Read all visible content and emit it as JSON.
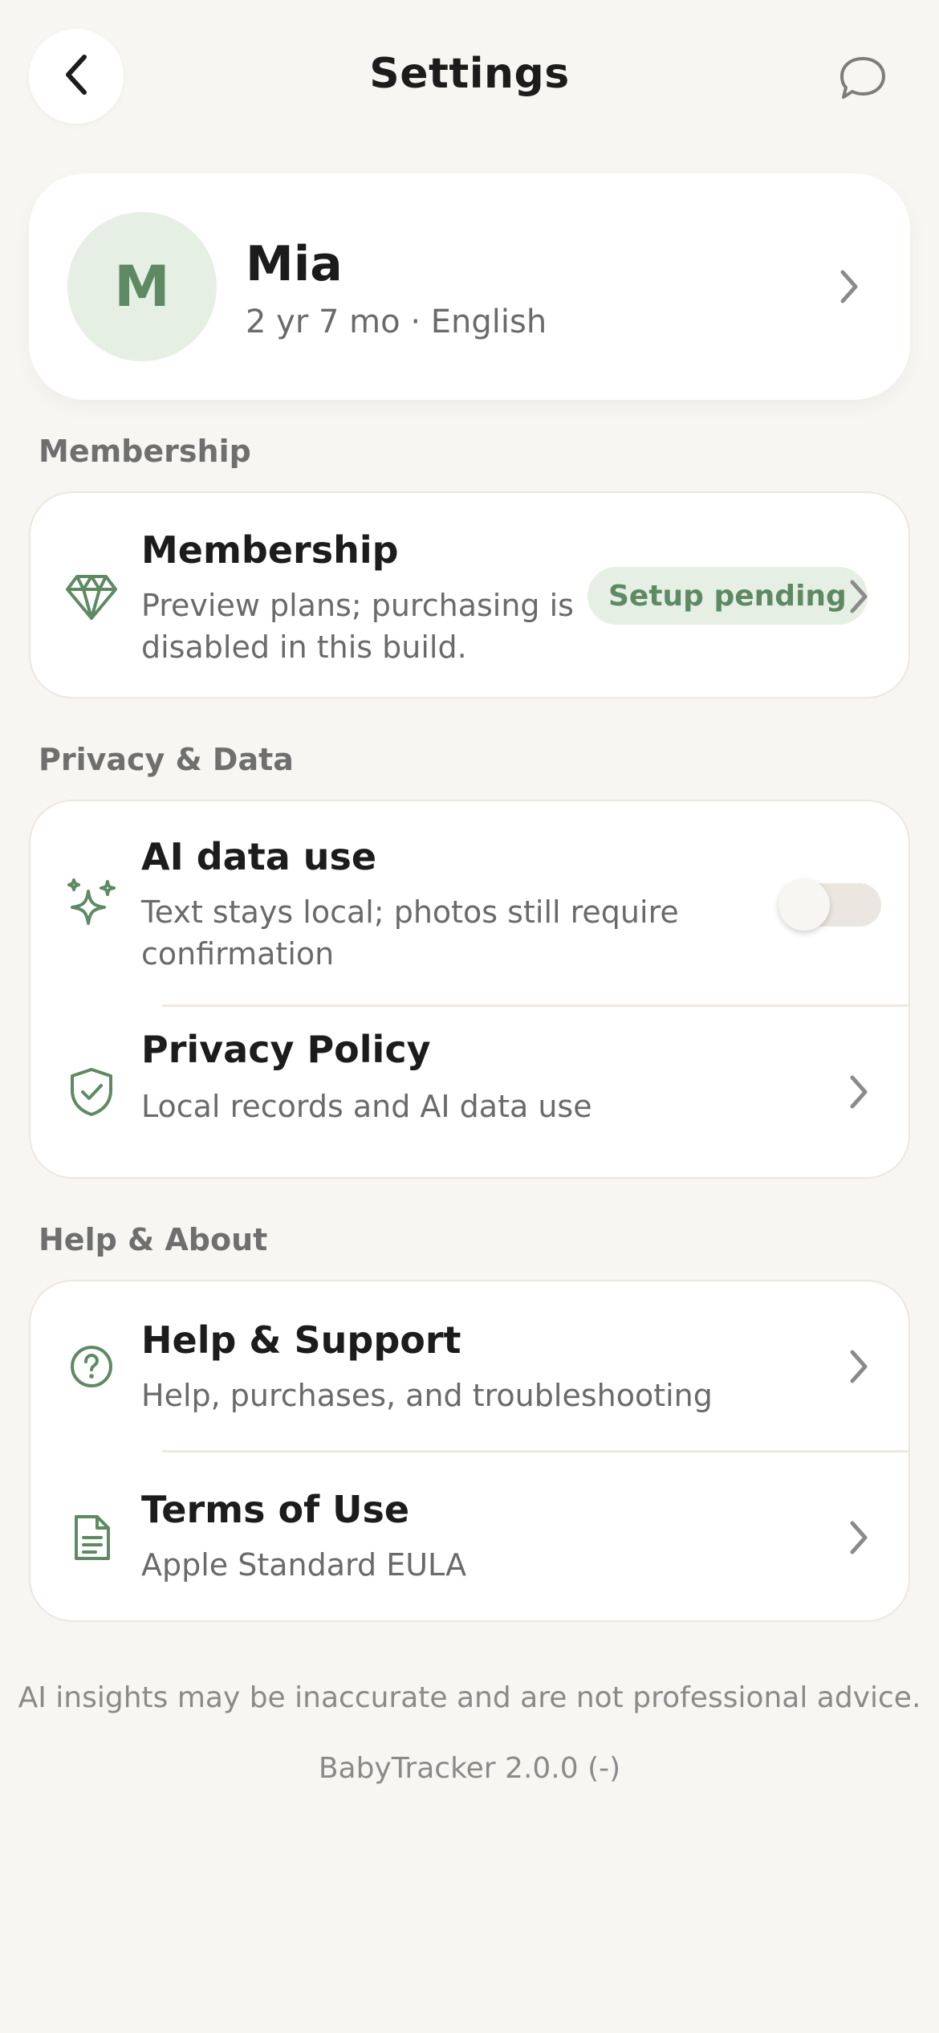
{
  "header": {
    "title": "Settings",
    "back_icon": "chevron-left-icon",
    "chat_icon": "chat-bubble-icon"
  },
  "profile": {
    "initial": "M",
    "name": "Mia",
    "details": "2 yr 7 mo · English"
  },
  "sections": {
    "membership": {
      "label": "Membership",
      "item": {
        "title": "Membership",
        "subtitle_line1": "Preview plans; purchasing is",
        "subtitle_line2": "disabled in this build.",
        "badge": "Setup pending",
        "icon": "diamond-icon"
      }
    },
    "privacy": {
      "label": "Privacy & Data",
      "ai_data": {
        "title": "AI data use",
        "subtitle_line1": "Text stays local; photos still require",
        "subtitle_line2": "confirmation",
        "toggle_on": false,
        "icon": "sparkles-icon"
      },
      "policy": {
        "title": "Privacy Policy",
        "subtitle": "Local records and AI data use",
        "icon": "shield-check-icon"
      }
    },
    "help": {
      "label": "Help & About",
      "support": {
        "title": "Help & Support",
        "subtitle": "Help, purchases, and troubleshooting",
        "icon": "question-circle-icon"
      },
      "terms": {
        "title": "Terms of Use",
        "subtitle": "Apple Standard EULA",
        "icon": "document-icon"
      }
    }
  },
  "footer": {
    "disclaimer": "AI insights may be inaccurate and are not professional advice.",
    "version": "BabyTracker 2.0.0 (-)"
  },
  "colors": {
    "background": "#f8f6f2",
    "accent": "#5e8a63",
    "accent_light": "#e6efe4",
    "card": "#ffffff"
  }
}
